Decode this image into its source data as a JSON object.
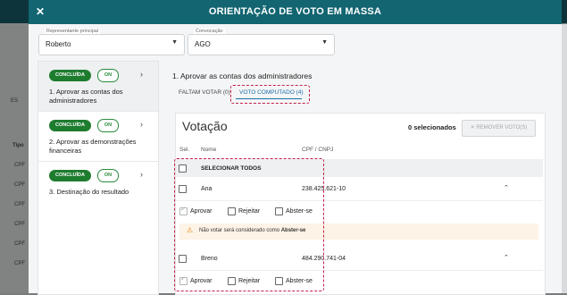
{
  "modal": {
    "title": "ORIENTAÇÃO DE VOTO EM MASSA",
    "close": "✕"
  },
  "filters": {
    "rep_label": "Representante principal",
    "rep_value": "Roberto",
    "conv_label": "Convocação",
    "conv_value": "AGO"
  },
  "steps": [
    {
      "status": "CONCLUÍDA",
      "toggle": "ON",
      "label": "1. Aprovar as contas dos administradores"
    },
    {
      "status": "CONCLUÍDA",
      "toggle": "ON",
      "label": "2. Aprovar as demonstrações financeiras"
    },
    {
      "status": "CONCLUÍDA",
      "toggle": "ON",
      "label": "3. Destinação do resultado"
    }
  ],
  "content": {
    "title": "1. Aprovar as contas dos administradores",
    "tabs": [
      "FALTAM VOTAR (0)",
      "VOTO COMPUTADO (4)"
    ]
  },
  "votacao": {
    "title": "Votação",
    "selected": "0 selecionados",
    "remove": "✕  REMOVER VOTO(S)",
    "headers": [
      "Sel.",
      "Nome",
      "CPF / CNPJ"
    ],
    "select_all": "SELECIONAR TODOS",
    "rows": [
      {
        "name": "Ana",
        "doc": "238.425.621-10"
      },
      {
        "name": "Breno",
        "doc": "484.290.741-04"
      }
    ],
    "options": [
      "Aprovar",
      "Rejeitar",
      "Abster-se"
    ],
    "warning_prefix": "Não votar será considerado como ",
    "warning_bold": "Abster-se"
  },
  "background": {
    "rows": [
      "Tipo",
      "CPF",
      "CPF",
      "CPF",
      "CPF",
      "CPF",
      "CPF"
    ],
    "side": "ES"
  }
}
